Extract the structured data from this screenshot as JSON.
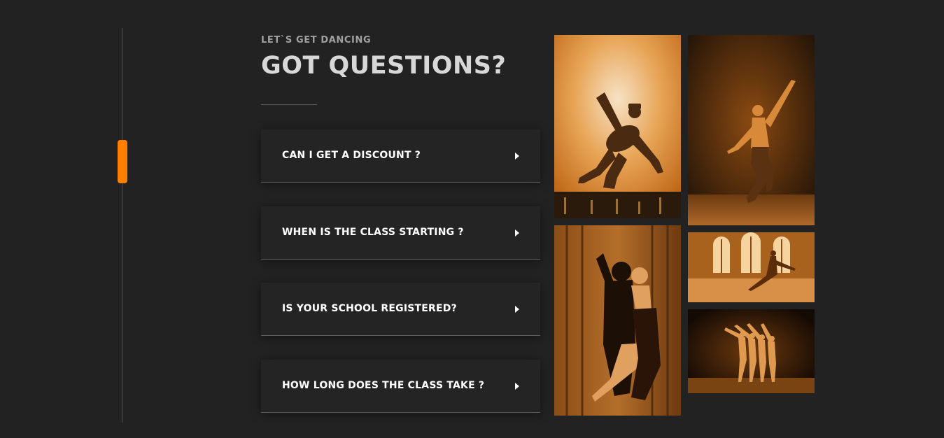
{
  "section": {
    "eyebrow": "LET`S GET DANCING",
    "title": "GOT QUESTIONS?"
  },
  "faq": {
    "items": [
      {
        "question": "CAN I GET A DISCOUNT ?"
      },
      {
        "question": "WHEN IS THE CLASS STARTING ?"
      },
      {
        "question": "IS YOUR SCHOOL REGISTERED?"
      },
      {
        "question": "HOW LONG DOES THE CLASS TAKE ?"
      }
    ]
  },
  "gallery": {
    "photos": [
      {
        "subject": "breakdancer-silhouette-photo"
      },
      {
        "subject": "male-dancer-stage-photo"
      },
      {
        "subject": "tango-couple-photo"
      },
      {
        "subject": "ballroom-dancers-photo"
      },
      {
        "subject": "ballet-group-photo"
      }
    ]
  },
  "theme": {
    "accent": "#ff7f00",
    "background": "#222222",
    "card": "#242424",
    "photo_tint": "#c46a10"
  }
}
